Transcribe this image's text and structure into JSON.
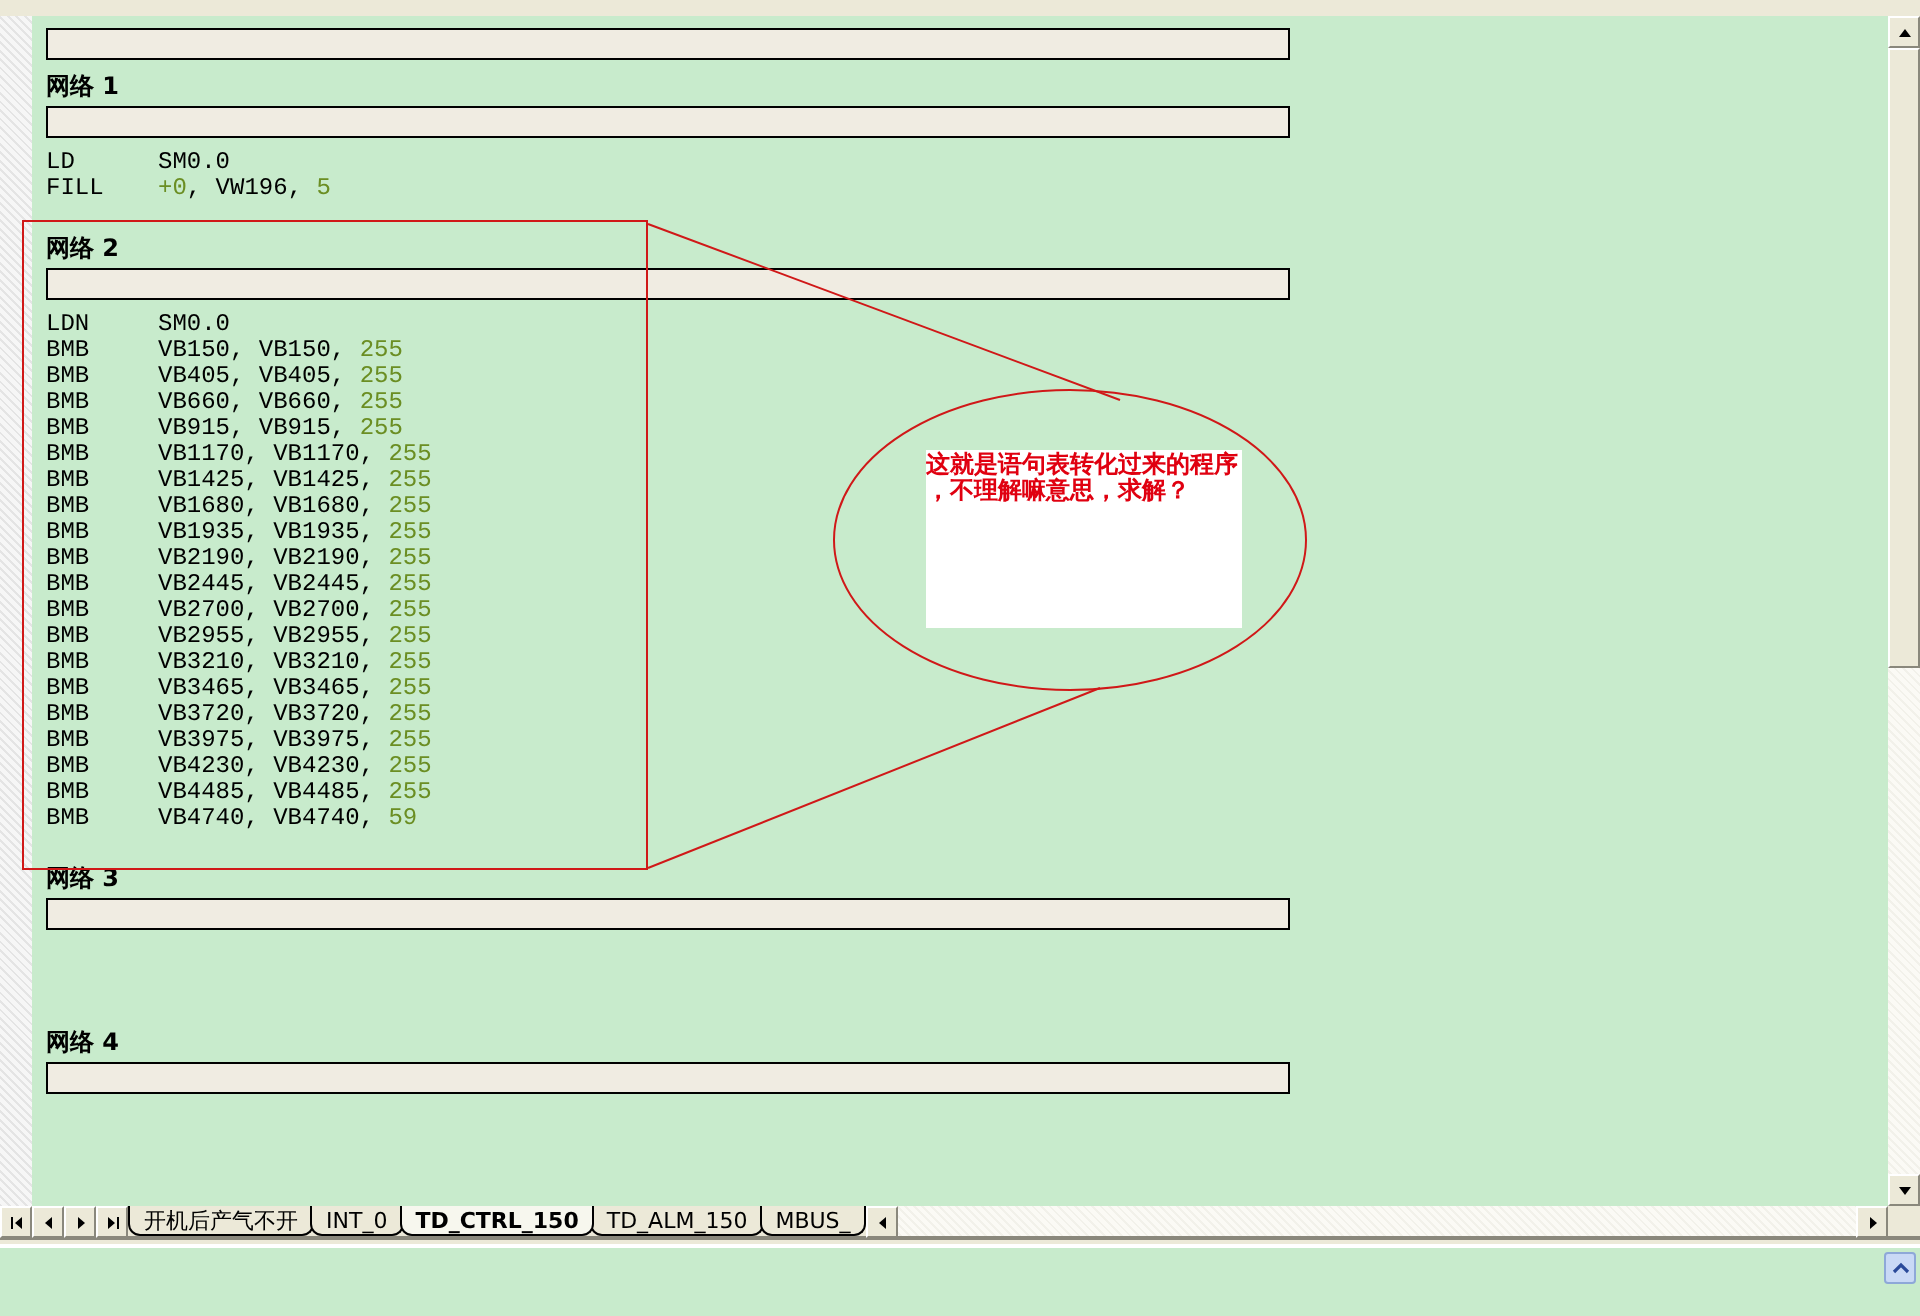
{
  "editor": {
    "networks": [
      {
        "comment_box": true
      },
      {
        "title": "网络 1",
        "comment_box": true,
        "lines": [
          {
            "op": "LD",
            "args": [
              {
                "text": "SM0.0",
                "kind": "operand"
              }
            ]
          },
          {
            "op": "FILL",
            "args": [
              {
                "text": "+0",
                "kind": "constant"
              },
              {
                "text": ", VW196, ",
                "kind": "operand"
              },
              {
                "text": "5",
                "kind": "constant"
              }
            ]
          }
        ]
      },
      {
        "title": "网络 2",
        "comment_box": true,
        "lines": [
          {
            "op": "LDN",
            "args": [
              {
                "text": "SM0.0",
                "kind": "operand"
              }
            ]
          },
          {
            "op": "BMB",
            "args": [
              {
                "text": "VB150, VB150, ",
                "kind": "operand"
              },
              {
                "text": "255",
                "kind": "constant"
              }
            ]
          },
          {
            "op": "BMB",
            "args": [
              {
                "text": "VB405, VB405, ",
                "kind": "operand"
              },
              {
                "text": "255",
                "kind": "constant"
              }
            ]
          },
          {
            "op": "BMB",
            "args": [
              {
                "text": "VB660, VB660, ",
                "kind": "operand"
              },
              {
                "text": "255",
                "kind": "constant"
              }
            ]
          },
          {
            "op": "BMB",
            "args": [
              {
                "text": "VB915, VB915, ",
                "kind": "operand"
              },
              {
                "text": "255",
                "kind": "constant"
              }
            ]
          },
          {
            "op": "BMB",
            "args": [
              {
                "text": "VB1170, VB1170, ",
                "kind": "operand"
              },
              {
                "text": "255",
                "kind": "constant"
              }
            ]
          },
          {
            "op": "BMB",
            "args": [
              {
                "text": "VB1425, VB1425, ",
                "kind": "operand"
              },
              {
                "text": "255",
                "kind": "constant"
              }
            ]
          },
          {
            "op": "BMB",
            "args": [
              {
                "text": "VB1680, VB1680, ",
                "kind": "operand"
              },
              {
                "text": "255",
                "kind": "constant"
              }
            ]
          },
          {
            "op": "BMB",
            "args": [
              {
                "text": "VB1935, VB1935, ",
                "kind": "operand"
              },
              {
                "text": "255",
                "kind": "constant"
              }
            ]
          },
          {
            "op": "BMB",
            "args": [
              {
                "text": "VB2190, VB2190, ",
                "kind": "operand"
              },
              {
                "text": "255",
                "kind": "constant"
              }
            ]
          },
          {
            "op": "BMB",
            "args": [
              {
                "text": "VB2445, VB2445, ",
                "kind": "operand"
              },
              {
                "text": "255",
                "kind": "constant"
              }
            ]
          },
          {
            "op": "BMB",
            "args": [
              {
                "text": "VB2700, VB2700, ",
                "kind": "operand"
              },
              {
                "text": "255",
                "kind": "constant"
              }
            ]
          },
          {
            "op": "BMB",
            "args": [
              {
                "text": "VB2955, VB2955, ",
                "kind": "operand"
              },
              {
                "text": "255",
                "kind": "constant"
              }
            ]
          },
          {
            "op": "BMB",
            "args": [
              {
                "text": "VB3210, VB3210, ",
                "kind": "operand"
              },
              {
                "text": "255",
                "kind": "constant"
              }
            ]
          },
          {
            "op": "BMB",
            "args": [
              {
                "text": "VB3465, VB3465, ",
                "kind": "operand"
              },
              {
                "text": "255",
                "kind": "constant"
              }
            ]
          },
          {
            "op": "BMB",
            "args": [
              {
                "text": "VB3720, VB3720, ",
                "kind": "operand"
              },
              {
                "text": "255",
                "kind": "constant"
              }
            ]
          },
          {
            "op": "BMB",
            "args": [
              {
                "text": "VB3975, VB3975, ",
                "kind": "operand"
              },
              {
                "text": "255",
                "kind": "constant"
              }
            ]
          },
          {
            "op": "BMB",
            "args": [
              {
                "text": "VB4230, VB4230, ",
                "kind": "operand"
              },
              {
                "text": "255",
                "kind": "constant"
              }
            ]
          },
          {
            "op": "BMB",
            "args": [
              {
                "text": "VB4485, VB4485, ",
                "kind": "operand"
              },
              {
                "text": "255",
                "kind": "constant"
              }
            ]
          },
          {
            "op": "BMB",
            "args": [
              {
                "text": "VB4740, VB4740, ",
                "kind": "operand"
              },
              {
                "text": "59",
                "kind": "constant"
              }
            ]
          }
        ]
      },
      {
        "title": "网络 3",
        "comment_box": true
      },
      {
        "title": "网络 4",
        "comment_box": true
      }
    ]
  },
  "annotation": {
    "note": "这就是语句表转化过来的程序，不理解嘛意思，求解？"
  },
  "tabs": [
    {
      "label": "开机后产气不开",
      "selected": false
    },
    {
      "label": "INT_0",
      "selected": false
    },
    {
      "label": "TD_CTRL_150",
      "selected": true
    },
    {
      "label": "TD_ALM_150",
      "selected": false
    },
    {
      "label": "MBUS_",
      "selected": false
    }
  ]
}
